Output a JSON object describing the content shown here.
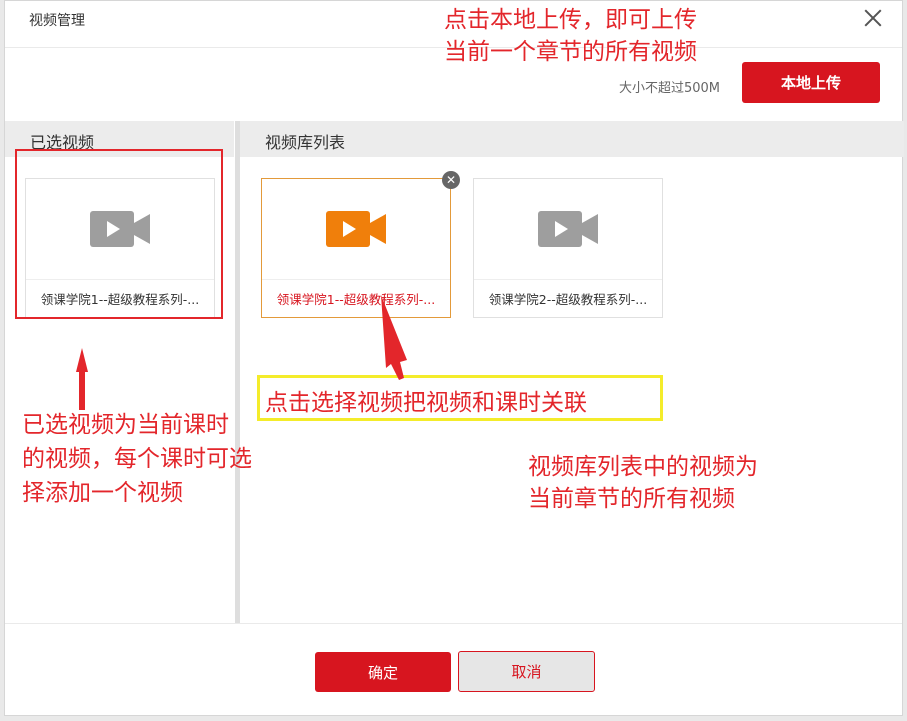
{
  "dialog": {
    "title": "视频管理",
    "close_icon": "close-icon"
  },
  "upload": {
    "size_limit": "大小不超过500M",
    "button_label": "本地上传"
  },
  "selected_panel": {
    "header": "已选视频",
    "items": [
      {
        "name": "领课学院1--超级教程系列-...",
        "icon": "video-camera-icon",
        "icon_color": "#9e9e9e"
      }
    ]
  },
  "library_panel": {
    "header": "视频库列表",
    "items": [
      {
        "name": "领课学院1--超级教程系列-...",
        "icon": "video-camera-icon",
        "icon_color": "#f07f0b",
        "selected": true
      },
      {
        "name": "领课学院2--超级教程系列-...",
        "icon": "video-camera-icon",
        "icon_color": "#9e9e9e",
        "selected": false
      }
    ]
  },
  "footer": {
    "ok_label": "确定",
    "cancel_label": "取消"
  },
  "annotations": {
    "top_right_line1": "点击本地上传，即可上传",
    "top_right_line2": "当前一个章节的所有视频",
    "left_line1": "已选视频为当前课时",
    "left_line2": "的视频，每个课时可选",
    "left_line3": "择添加一个视频",
    "middle_box": "点击选择视频把视频和课时关联",
    "right_line1": "视频库列表中的视频为",
    "right_line2": "当前章节的所有视频"
  },
  "colors": {
    "brand_red": "#d7151f",
    "annotation_red": "#e3262b",
    "highlight_yellow": "#f4ec2a",
    "selected_border": "#e39a3a"
  }
}
